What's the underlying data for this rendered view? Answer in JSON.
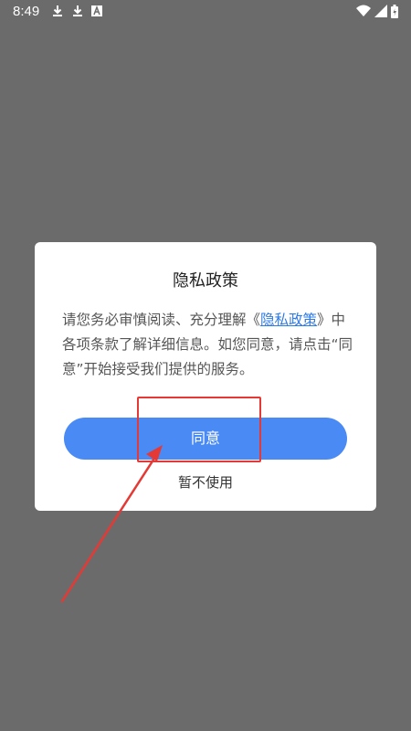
{
  "status_bar": {
    "time": "8:49",
    "left_icons": [
      "download-icon",
      "download-icon",
      "font-icon"
    ],
    "right_icons": [
      "wifi-icon",
      "signal-icon",
      "battery-icon"
    ]
  },
  "dialog": {
    "title": "隐私政策",
    "body_before_link": "请您务必审慎阅读、充分理解《",
    "link_text": "隐私政策",
    "body_after_link": "》中各项条款了解详细信息。如您同意，请点击“同意”开始接受我们提供的服务。",
    "agree_label": "同意",
    "decline_label": "暂不使用"
  },
  "colors": {
    "overlay": "#6b6b6b",
    "accent": "#4a8af4",
    "link": "#2e7be5",
    "annotation": "#e53935"
  }
}
